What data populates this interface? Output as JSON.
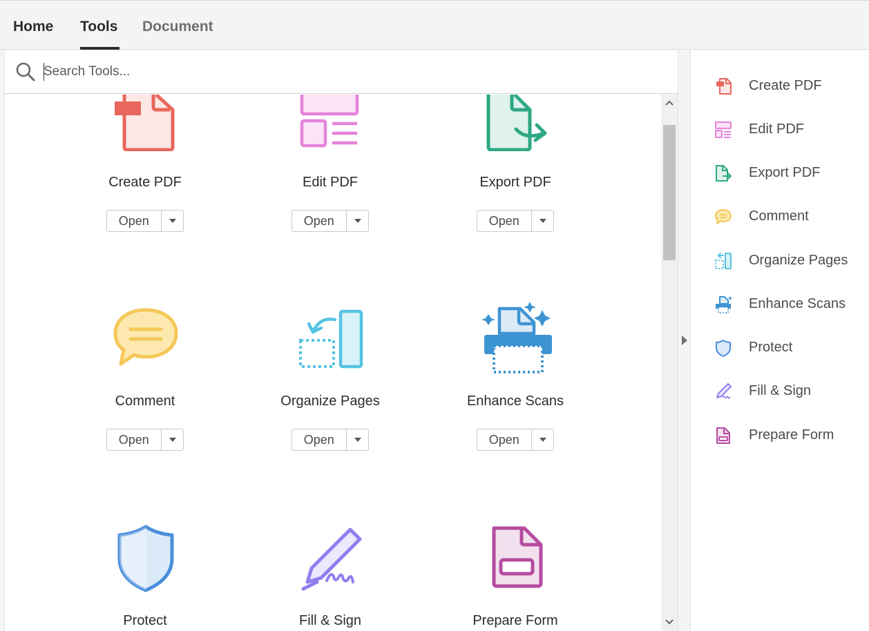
{
  "tabs": {
    "home": "Home",
    "tools": "Tools",
    "document": "Document"
  },
  "search": {
    "placeholder": "Search Tools..."
  },
  "tools": [
    {
      "label": "Create PDF",
      "button": "Open",
      "icon": "create-pdf-icon",
      "color": "#e8675c"
    },
    {
      "label": "Edit PDF",
      "button": "Open",
      "icon": "edit-pdf-icon",
      "color": "#e583d9"
    },
    {
      "label": "Export PDF",
      "button": "Open",
      "icon": "export-pdf-icon",
      "color": "#2ea884"
    },
    {
      "label": "Comment",
      "button": "Open",
      "icon": "comment-icon",
      "color": "#f5c858"
    },
    {
      "label": "Organize Pages",
      "button": "Open",
      "icon": "organize-pages-icon",
      "color": "#55c4e2"
    },
    {
      "label": "Enhance Scans",
      "button": "Open",
      "icon": "enhance-scans-icon",
      "color": "#3d94d2"
    },
    {
      "label": "Protect",
      "icon": "shield-icon",
      "color": "#4a8fdb"
    },
    {
      "label": "Fill & Sign",
      "icon": "fill-sign-icon",
      "color": "#8e7ff0"
    },
    {
      "label": "Prepare Form",
      "icon": "prepare-form-icon",
      "color": "#b54ca0"
    }
  ],
  "right_pane": [
    {
      "label": "Create PDF",
      "icon": "create-pdf-icon"
    },
    {
      "label": "Edit PDF",
      "icon": "edit-pdf-icon"
    },
    {
      "label": "Export PDF",
      "icon": "export-pdf-icon"
    },
    {
      "label": "Comment",
      "icon": "comment-icon"
    },
    {
      "label": "Organize Pages",
      "icon": "organize-pages-icon"
    },
    {
      "label": "Enhance Scans",
      "icon": "enhance-scans-icon"
    },
    {
      "label": "Protect",
      "icon": "shield-icon"
    },
    {
      "label": "Fill & Sign",
      "icon": "fill-sign-icon"
    },
    {
      "label": "Prepare Form",
      "icon": "prepare-form-icon"
    }
  ]
}
